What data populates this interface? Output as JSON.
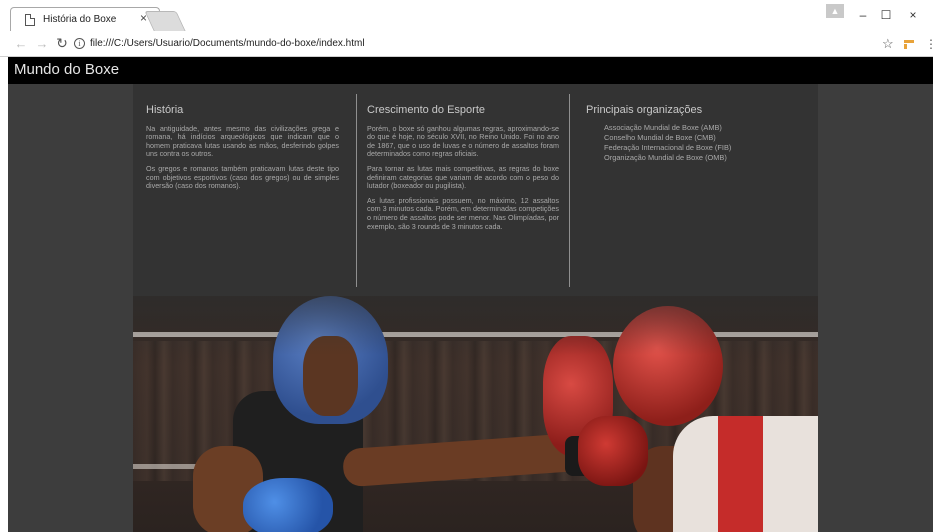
{
  "browser": {
    "tab_title": "História do Boxe",
    "tab_close": "×",
    "url": "file:///C:/Users/Usuario/Documents/mundo-do-boxe/index.html",
    "window_controls": [
      "–",
      "☐",
      "×"
    ]
  },
  "site": {
    "title": "Mundo do Boxe"
  },
  "columns": {
    "historia": {
      "heading": "História",
      "paragraphs": [
        "Na antiguidade, antes mesmo das civilizações grega e romana, há indícios arqueológicos que indicam que o homem praticava lutas usando as mãos, desferindo golpes uns contra os outros.",
        "Os gregos e romanos também praticavam lutas deste tipo com objetivos esportivos (caso dos gregos) ou de simples diversão (caso dos romanos)."
      ]
    },
    "crescimento": {
      "heading": "Crescimento do Esporte",
      "paragraphs": [
        "Porém, o boxe só ganhou algumas regras, aproximando-se do que é hoje, no século XVII, no Reino Unido. Foi no ano de 1867, que o uso de luvas e o número de assaltos foram determinados como regras oficiais.",
        "Para tornar as lutas mais competitivas, as regras do boxe definiram categorias que variam de acordo com o peso do lutador (boxeador ou pugilista).",
        "As lutas profissionais possuem, no máximo, 12 assaltos com 3 minutos cada. Porém, em determinadas competições o número de assaltos pode ser menor. Nas Olimpíadas, por exemplo, são 3 rounds de 3 minutos cada."
      ]
    },
    "organizacoes": {
      "heading": "Principais organizações",
      "items": [
        "Associação Mundial de Boxe (AMB)",
        "Conselho Mundial de Boxe (CMB)",
        "Federação Internacional de Boxe (FIB)",
        "Organização Mundial de Boxe (OMB)"
      ]
    }
  },
  "icons": {
    "back": "back-arrow-icon",
    "forward": "forward-arrow-icon",
    "reload": "reload-icon",
    "info": "info-icon",
    "bookmark": "star-icon",
    "extension": "extension-icon",
    "menu": "menu-dots-icon"
  }
}
